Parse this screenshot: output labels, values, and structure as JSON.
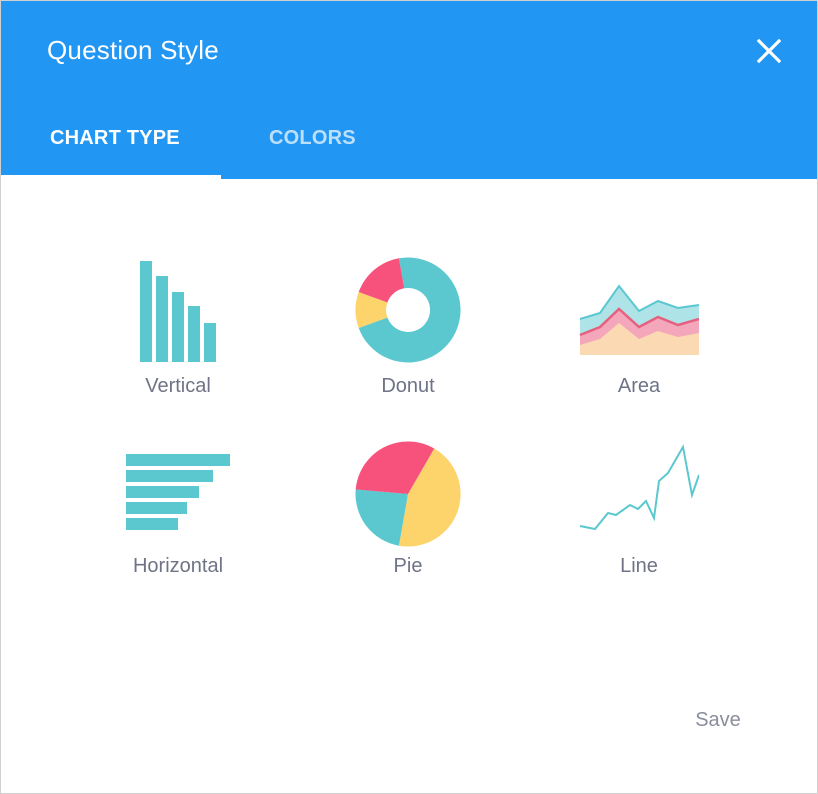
{
  "dialog": {
    "title": "Question Style",
    "close_icon": "close-icon"
  },
  "tabs": [
    {
      "label": "CHART TYPE",
      "active": true
    },
    {
      "label": "COLORS",
      "active": false
    }
  ],
  "chart_types": [
    {
      "label": "Vertical",
      "icon": "vertical-bar-chart-icon"
    },
    {
      "label": "Donut",
      "icon": "donut-chart-icon"
    },
    {
      "label": "Area",
      "icon": "area-chart-icon"
    },
    {
      "label": "Horizontal",
      "icon": "horizontal-bar-chart-icon"
    },
    {
      "label": "Pie",
      "icon": "pie-chart-icon"
    },
    {
      "label": "Line",
      "icon": "line-chart-icon"
    }
  ],
  "actions": {
    "save_label": "Save"
  },
  "colors": {
    "header": "#2196f3",
    "teal": "#5bc8d0",
    "pink": "#f7527c",
    "yellow": "#fdd36b",
    "area_light_teal": "#aee4e8",
    "area_peach": "#fbd9b3",
    "area_pink_line": "#e6607f",
    "label_text": "#6f7385",
    "save_text": "#8a8d9c"
  }
}
